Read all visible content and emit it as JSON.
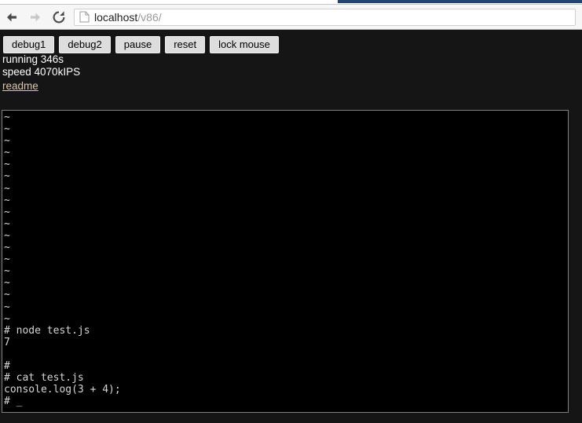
{
  "browser": {
    "back_icon": "back-arrow-icon",
    "forward_icon": "forward-arrow-icon",
    "reload_icon": "reload-icon",
    "page_icon": "document-page-icon",
    "url_host": "localhost",
    "url_path": "/v86/",
    "url_full": "localhost/v86/"
  },
  "app": {
    "buttons": [
      {
        "label": "debug1",
        "name": "debug1-button"
      },
      {
        "label": "debug2",
        "name": "debug2-button"
      },
      {
        "label": "pause",
        "name": "pause-button"
      },
      {
        "label": "reset",
        "name": "reset-button"
      },
      {
        "label": "lock mouse",
        "name": "lock-mouse-button"
      }
    ],
    "status": {
      "running": "running 346s",
      "speed": "speed 4070kIPS"
    },
    "readme_label": "readme"
  },
  "terminal": {
    "lines": [
      "~",
      "~",
      "~",
      "~",
      "~",
      "~",
      "~",
      "~",
      "~",
      "~",
      "~",
      "~",
      "~",
      "~",
      "~",
      "~",
      "~",
      "~",
      "# node test.js",
      "7",
      "",
      "#",
      "# cat test.js",
      "console.log(3 + 4);",
      "# _"
    ],
    "prompt": "#",
    "cursor": "_",
    "colors": {
      "background": "#000000",
      "foreground": "#d6d6d6",
      "border": "#808080"
    }
  },
  "colors": {
    "page_background": "#151515",
    "link": "#d8c8a6",
    "status_text": "#ffffff",
    "tab_active": "#21456e"
  }
}
